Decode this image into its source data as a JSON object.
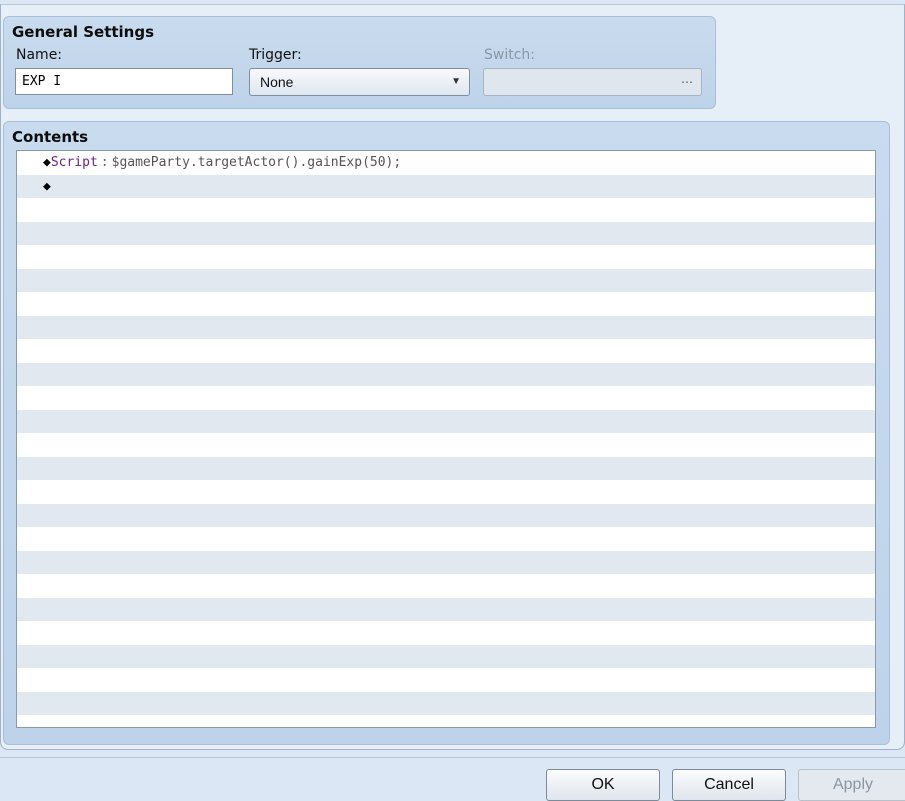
{
  "general": {
    "title": "General Settings",
    "name_label": "Name:",
    "name_value": "EXP I",
    "trigger_label": "Trigger:",
    "trigger_value": "None",
    "switch_label": "Switch:",
    "switch_button": "…"
  },
  "contents": {
    "title": "Contents",
    "rows": [
      {
        "marker": "◆",
        "command": "Script",
        "separator": ":",
        "text": "$gameParty.targetActor().gainExp(50);"
      },
      {
        "marker": "◆",
        "command": "",
        "separator": "",
        "text": ""
      }
    ]
  },
  "buttons": {
    "ok": "OK",
    "cancel": "Cancel",
    "apply": "Apply"
  }
}
